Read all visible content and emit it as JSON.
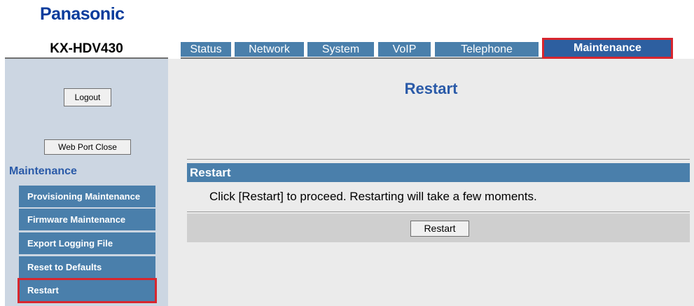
{
  "header": {
    "brand": "Panasonic",
    "model": "KX-HDV430"
  },
  "tabs": [
    {
      "label": "Status",
      "active": false
    },
    {
      "label": "Network",
      "active": false
    },
    {
      "label": "System",
      "active": false
    },
    {
      "label": "VoIP",
      "active": false
    },
    {
      "label": "Telephone",
      "active": false
    },
    {
      "label": "Maintenance",
      "active": true
    }
  ],
  "sidebar": {
    "logout_label": "Logout",
    "web_port_close_label": "Web Port Close",
    "heading": "Maintenance",
    "items": [
      {
        "label": "Provisioning Maintenance"
      },
      {
        "label": "Firmware Maintenance"
      },
      {
        "label": "Export Logging File"
      },
      {
        "label": "Reset to Defaults"
      },
      {
        "label": "Restart",
        "selected": true
      }
    ]
  },
  "main": {
    "title": "Restart",
    "section_title": "Restart",
    "description": "Click [Restart] to proceed. Restarting will take a few moments.",
    "restart_button_label": "Restart"
  },
  "colors": {
    "brand": "#0a3c9c",
    "tab_bg": "#4a7fab",
    "tab_active_bg": "#2d5fa0",
    "sidebar_bg": "#ccd6e2",
    "main_bg": "#ebebeb",
    "highlight": "#d8262e",
    "title": "#2a5aa8"
  }
}
